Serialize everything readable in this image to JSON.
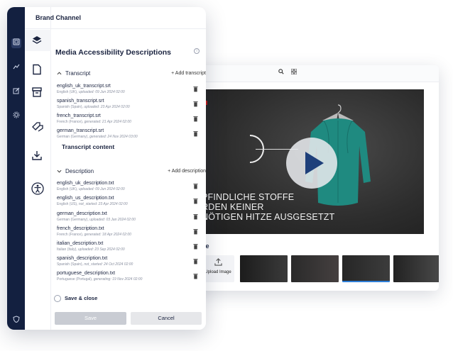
{
  "panel": {
    "brand": "Brand Channel",
    "title": "Media Accessibility Descriptions",
    "transcript": {
      "heading": "Transcript",
      "add_label": "+ Add transcript",
      "content_label": "Transcript content",
      "files": [
        {
          "name": "english_uk_transcript.srt",
          "lang": "English (UK),",
          "status": "uploaded: 09 Jun 2024 02:00"
        },
        {
          "name": "spanish_transcript.srt",
          "lang": "Spanish (Spain),",
          "status": "uploaded: 23 Apr 2024 02:00"
        },
        {
          "name": "french_transcript.srt",
          "lang": "French (France),",
          "status": "generated: 21 Apr 2024 02:00"
        },
        {
          "name": "german_transcript.srt",
          "lang": "German (Germany),",
          "status": "generated: 24 Nov 2024 03:00"
        }
      ]
    },
    "description": {
      "heading": "Description",
      "add_label": "+ Add description",
      "files": [
        {
          "name": "english_uk_description.txt",
          "lang": "English (UK),",
          "status": "uploaded: 09 Jun 2024 02:00"
        },
        {
          "name": "english_us_description.txt",
          "lang": "English (US),",
          "status": "not_started: 23 Apr 2024 02:00"
        },
        {
          "name": "german_description.txt",
          "lang": "German (Germany),",
          "status": "uploaded: 03 Jan 2024 02:00"
        },
        {
          "name": "french_description.txt",
          "lang": "French (France),",
          "status": "generated: 18 Apr 2024 02:00"
        },
        {
          "name": "italian_description.txt",
          "lang": "Italian (Italy),",
          "status": "uploaded: 23 Sep 2024 02:00"
        },
        {
          "name": "spanish_description.txt",
          "lang": "Spanish (Spain),",
          "status": "not_started: 24 Oct 2024 02:00"
        },
        {
          "name": "portuguese_description.txt",
          "lang": "Portuguese (Portugal),",
          "status": "generating: 19 Nov 2024 02:00"
        }
      ]
    },
    "save_close_label": "Save & close",
    "save_label": "Save",
    "cancel_label": "Cancel"
  },
  "video": {
    "overlay_lines": [
      "PFINDLICHE STOFFE",
      "RDEN KEINER",
      "NÖTIGEN HITZE AUSGESETZT"
    ],
    "section_label": "ge",
    "upload_label": "Upload Image"
  },
  "colors": {
    "rail": "#132040",
    "text": "#1b2440",
    "play": "#1e3f7a",
    "shirt": "#1f8a80",
    "accent_red": "#c41a1a",
    "selection": "#2f7fd8"
  },
  "icons": [
    "gallery-icon",
    "analytics-icon",
    "edit-icon",
    "gear-icon",
    "shield-icon",
    "layers-icon",
    "document-icon",
    "archive-icon",
    "tags-icon",
    "download-icon",
    "accessibility-icon",
    "info-icon",
    "chevron-down-icon",
    "trash-icon",
    "search-icon",
    "grid-icon",
    "upload-icon",
    "play-icon"
  ]
}
